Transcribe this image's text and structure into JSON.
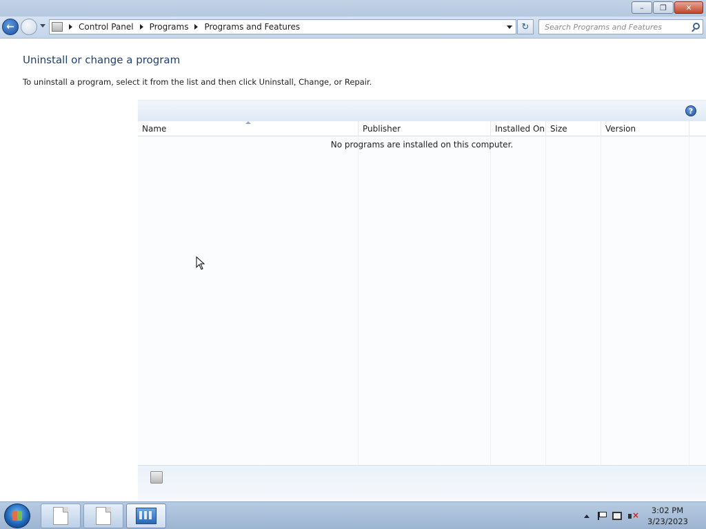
{
  "window": {
    "minimize_glyph": "–",
    "maximize_glyph": "❐",
    "close_glyph": "✕"
  },
  "nav": {
    "breadcrumbs": [
      "Control Panel",
      "Programs",
      "Programs and Features"
    ],
    "refresh_glyph": "↻",
    "search_placeholder": "Search Programs and Features"
  },
  "content": {
    "title": "Uninstall or change a program",
    "description": "To uninstall a program, select it from the list and then click Uninstall, Change, or Repair.",
    "help_glyph": "?",
    "columns": [
      "Name",
      "Publisher",
      "Installed On",
      "Size",
      "Version"
    ],
    "empty_message": "No programs are installed on this computer."
  },
  "taskbar": {
    "clock_time": "3:02 PM",
    "clock_date": "3/23/2023"
  },
  "colors": {
    "title_text": "#1e3f73",
    "accent": "#2c67b5"
  },
  "icons": [
    "back-arrow-icon",
    "forward-arrow-icon",
    "control-panel-icon",
    "refresh-icon",
    "search-icon",
    "help-icon",
    "programs-icon",
    "start-orb-icon",
    "document-icon",
    "control-panel-taskbar-icon",
    "flag-icon",
    "network-icon",
    "volume-muted-icon",
    "mouse-cursor-icon"
  ]
}
